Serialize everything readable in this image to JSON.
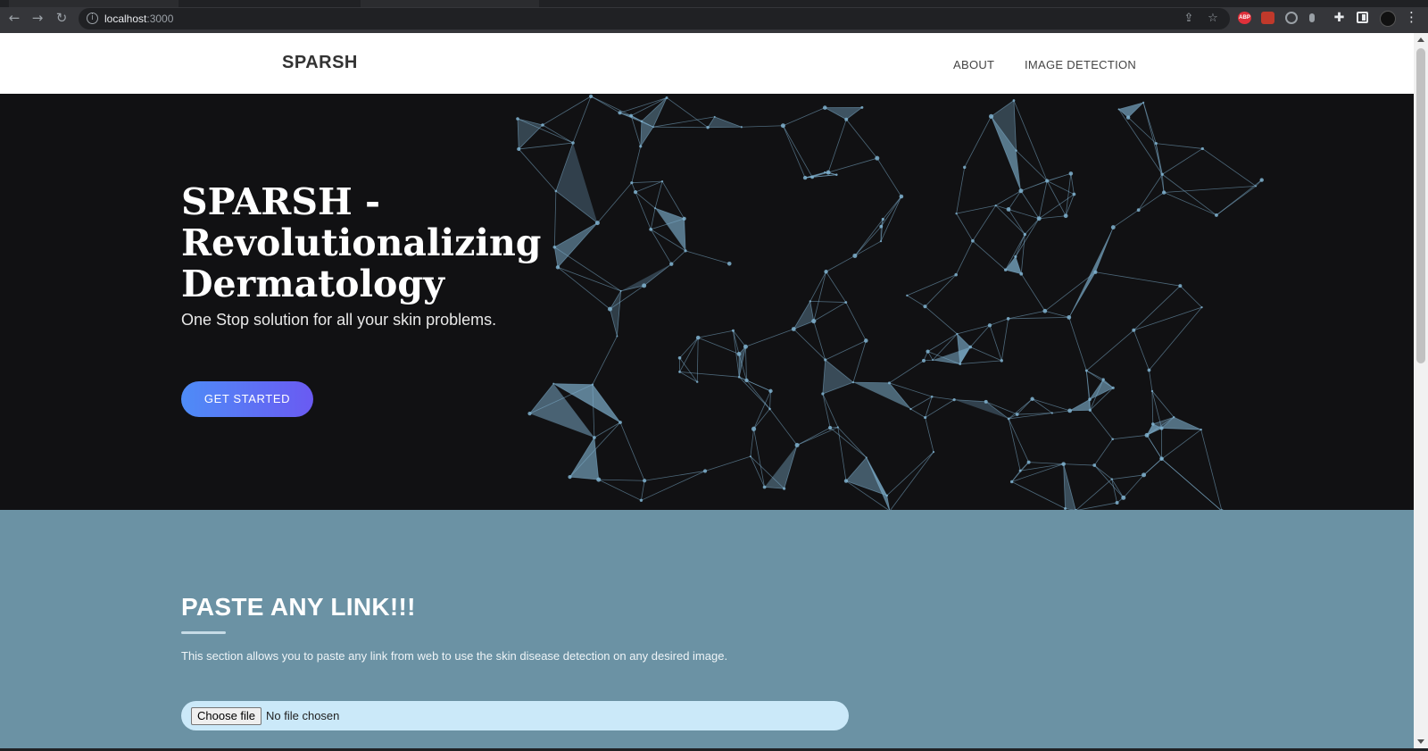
{
  "browser": {
    "url_host": "localhost",
    "url_port": ":3000"
  },
  "site": {
    "brand": "SPARSH",
    "nav": [
      "ABOUT",
      "IMAGE DETECTION"
    ]
  },
  "hero": {
    "title": "SPARSH - Revolutionalizing Dermatology",
    "subtitle": "One Stop solution for all your skin problems.",
    "cta_label": "GET STARTED"
  },
  "paste_section": {
    "title": "PASTE ANY LINK!!!",
    "description": "This section allows you to paste any link from web to use the skin disease detection on any desired image.",
    "file_button_label": "Choose file",
    "file_status": "No file chosen"
  },
  "colors": {
    "hero_bg": "#111113",
    "network": "#7fb1cf",
    "section_bg": "#6b92a4",
    "cta_start": "#4e8cf7",
    "cta_end": "#6a5af2",
    "file_field_bg": "#cbe9f9"
  }
}
